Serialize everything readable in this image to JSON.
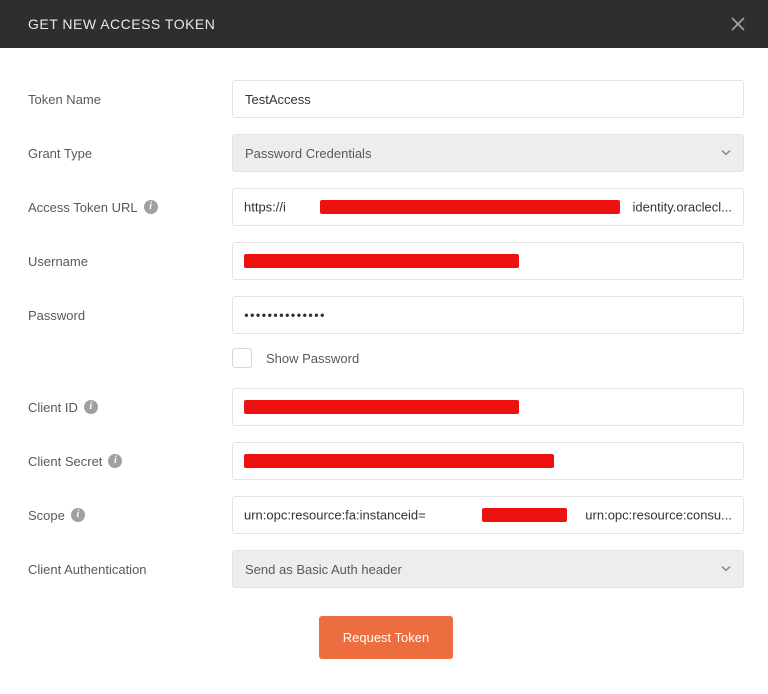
{
  "header": {
    "title": "GET NEW ACCESS TOKEN"
  },
  "form": {
    "tokenName": {
      "label": "Token Name",
      "value": "TestAccess"
    },
    "grantType": {
      "label": "Grant Type",
      "selected": "Password Credentials"
    },
    "accessTokenUrl": {
      "label": "Access Token URL",
      "prefix": "https://i",
      "suffix": "identity.oraclecl..."
    },
    "username": {
      "label": "Username"
    },
    "password": {
      "label": "Password",
      "masked": "●●●●●●●●●●●●●●"
    },
    "showPassword": {
      "label": "Show Password",
      "checked": false
    },
    "clientId": {
      "label": "Client ID"
    },
    "clientSecret": {
      "label": "Client Secret"
    },
    "scope": {
      "label": "Scope",
      "prefix": "urn:opc:resource:fa:instanceid=",
      "suffix": "urn:opc:resource:consu..."
    },
    "clientAuthentication": {
      "label": "Client Authentication",
      "selected": "Send as Basic Auth header"
    }
  },
  "actions": {
    "requestToken": "Request Token"
  }
}
